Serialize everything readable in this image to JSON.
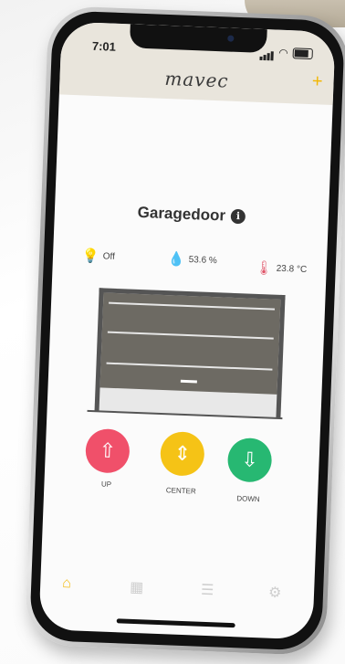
{
  "status_bar": {
    "time": "7:01"
  },
  "header": {
    "brand": "mavec",
    "add_icon": "plus-icon"
  },
  "device": {
    "name": "Garagedoor",
    "info_icon": "info-icon"
  },
  "sensors": {
    "light": {
      "icon": "lightbulb-icon",
      "value": "Off"
    },
    "humidity": {
      "icon": "droplet-icon",
      "value": "53.6 %"
    },
    "temperature": {
      "icon": "thermometer-icon",
      "value": "23.8 °C"
    }
  },
  "door": {
    "open_fraction": 0.2
  },
  "controls": {
    "up": {
      "label": "UP",
      "color": "#f0506a"
    },
    "center": {
      "label": "CENTER",
      "color": "#f5c316"
    },
    "down": {
      "label": "DOWN",
      "color": "#27b872"
    }
  },
  "tabbar": {
    "active_color": "#f2b705",
    "items": [
      "home-icon",
      "grid-icon",
      "list-icon",
      "settings-icon"
    ]
  }
}
